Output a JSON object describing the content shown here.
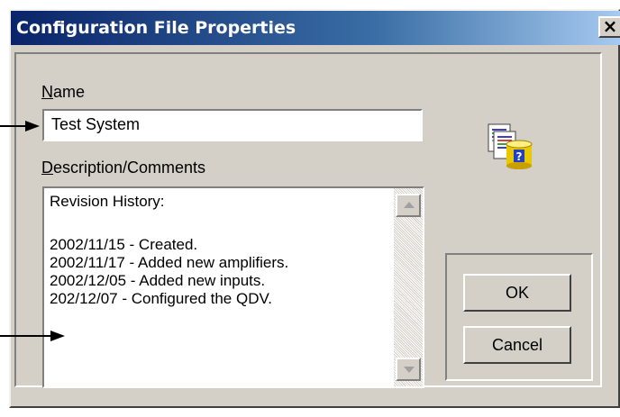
{
  "window": {
    "title": "Configuration File Properties",
    "close_label": "×"
  },
  "form": {
    "name_label_mnemonic": "N",
    "name_label_rest": "ame",
    "name_value": "Test System",
    "desc_label_mnemonic": "D",
    "desc_label_rest": "escription/Comments",
    "desc_lines": [
      "Revision History:",
      "",
      "2002/11/15 - Created.",
      "2002/11/17 - Added new amplifiers.",
      "2002/12/05 - Added new inputs.",
      "202/12/07 - Configured the QDV."
    ]
  },
  "buttons": {
    "ok_label": "OK",
    "cancel_label": "Cancel"
  },
  "icons": {
    "properties": "document-database-help-icon",
    "close": "close-icon",
    "scroll_up": "up-arrow-icon",
    "scroll_down": "down-arrow-icon"
  },
  "colors": {
    "title_start": "#0a246a",
    "title_end": "#a6caf0",
    "face": "#d4d0c8"
  }
}
